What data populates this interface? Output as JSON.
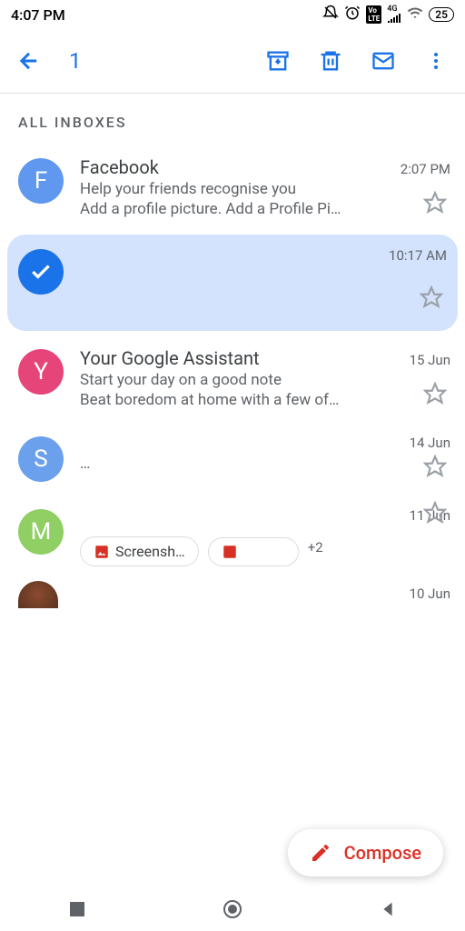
{
  "status_bar": {
    "time": "4:07 PM",
    "battery": "25"
  },
  "app_bar": {
    "selected_count": "1"
  },
  "section_label": "ALL INBOXES",
  "emails": [
    {
      "avatar_letter": "F",
      "avatar_color": "#5f98ee",
      "sender": "Facebook",
      "time": "2:07 PM",
      "subject": "Help your friends recognise you",
      "snippet": "Add a profile picture. Add a Profile Pi…",
      "selected": false
    },
    {
      "avatar_letter": "✓",
      "avatar_color": "#1a73e8",
      "sender": "",
      "time": "10:17 AM",
      "subject": "",
      "snippet": "",
      "selected": true
    },
    {
      "avatar_letter": "Y",
      "avatar_color": "#e6457a",
      "sender": "Your Google Assistant",
      "time": "15 Jun",
      "subject": "Start your day on a good note",
      "snippet": "Beat boredom at home with a few of…",
      "selected": false
    },
    {
      "avatar_letter": "S",
      "avatar_color": "#6aa0ec",
      "sender": "",
      "time": "14 Jun",
      "subject": "",
      "snippet": "…",
      "selected": false
    },
    {
      "avatar_letter": "M",
      "avatar_color": "#8fcf63",
      "sender": "",
      "time": "11 Jun",
      "subject": "",
      "snippet": "",
      "selected": false,
      "attachments": {
        "name": "Screensh…",
        "more": "+2"
      }
    }
  ],
  "partial_email": {
    "time": "10 Jun"
  },
  "compose": {
    "label": "Compose"
  }
}
